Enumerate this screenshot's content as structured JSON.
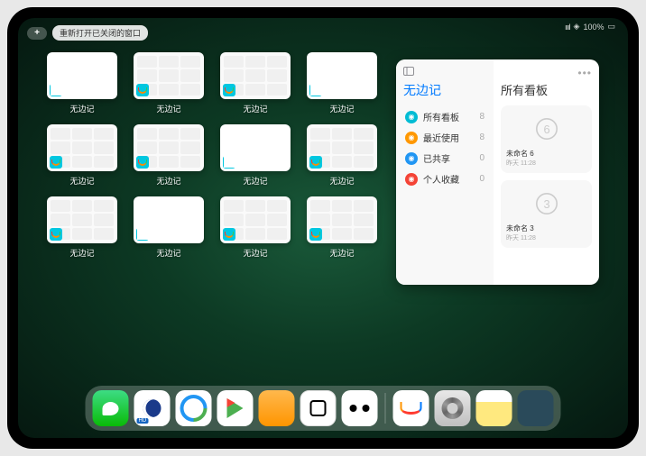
{
  "status": {
    "battery": "100%",
    "wifi": "▲"
  },
  "top_buttons": {
    "plus": "+",
    "reopen_label": "重新打开已关闭的窗口"
  },
  "app_switcher": {
    "grid_label": "无边记",
    "thumbs": [
      {
        "style": "blank"
      },
      {
        "style": "grid"
      },
      {
        "style": "grid"
      },
      {
        "style": "blank"
      },
      {
        "style": "grid"
      },
      {
        "style": "grid"
      },
      {
        "style": "blank"
      },
      {
        "style": "grid"
      },
      {
        "style": "grid"
      },
      {
        "style": "blank"
      },
      {
        "style": "grid"
      },
      {
        "style": "grid"
      }
    ]
  },
  "large_window": {
    "sidebar_title": "无边记",
    "items": [
      {
        "icon_color": "#00bcd4",
        "label": "所有看板",
        "count": 8
      },
      {
        "icon_color": "#ff9800",
        "label": "最近使用",
        "count": 8
      },
      {
        "icon_color": "#2196f3",
        "label": "已共享",
        "count": 0
      },
      {
        "icon_color": "#f44336",
        "label": "个人收藏",
        "count": 0
      }
    ],
    "main_title": "所有看板",
    "cards": [
      {
        "label": "未命名 6",
        "sub": "昨天 11:28",
        "digit": "6"
      },
      {
        "label": "未命名 3",
        "sub": "昨天 11:28",
        "digit": "3"
      }
    ]
  },
  "dock": {
    "apps": [
      {
        "name": "wechat"
      },
      {
        "name": "quark"
      },
      {
        "name": "q-browser"
      },
      {
        "name": "play-store"
      },
      {
        "name": "books"
      },
      {
        "name": "game"
      },
      {
        "name": "connect"
      }
    ],
    "right_apps": [
      {
        "name": "freeform"
      },
      {
        "name": "settings"
      },
      {
        "name": "notes"
      },
      {
        "name": "recents-folder"
      }
    ]
  }
}
